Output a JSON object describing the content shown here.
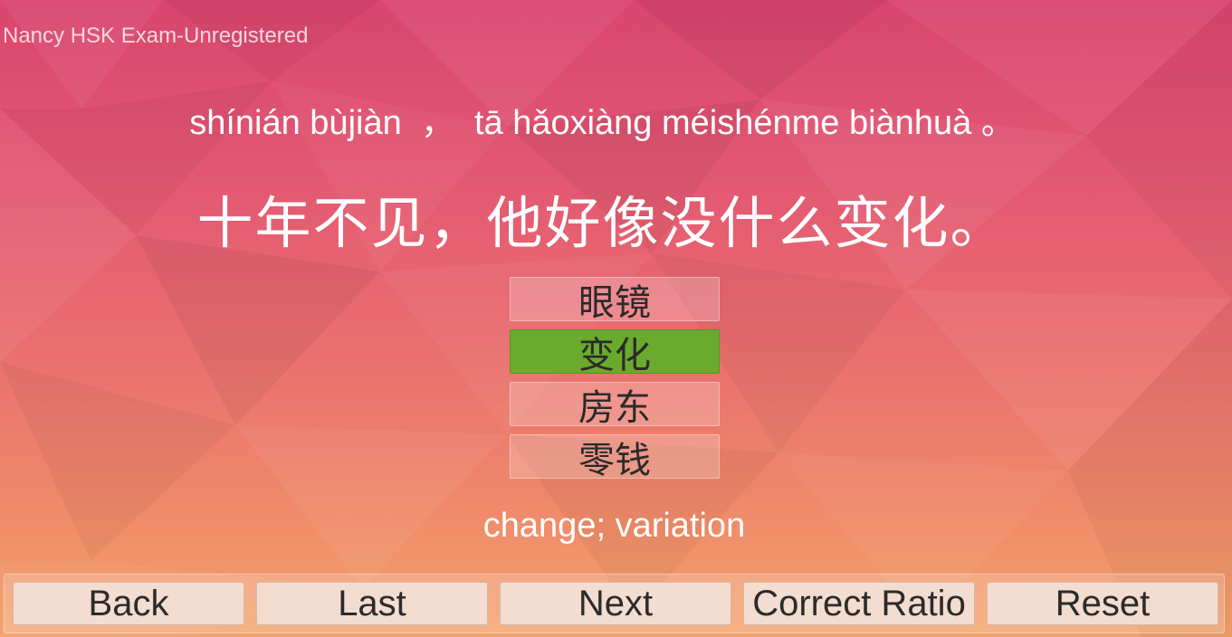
{
  "app": {
    "title": "Nancy HSK Exam-Unregistered"
  },
  "question": {
    "pinyin": "shínián bùjiàn  ，  tā hǎoxiàng méishénme biànhuà 。",
    "hanzi": "十年不见，他好像没什么变化。"
  },
  "choices": [
    {
      "label": "眼镜",
      "selected": false
    },
    {
      "label": "变化",
      "selected": true
    },
    {
      "label": "房东",
      "selected": false
    },
    {
      "label": "零钱",
      "selected": false
    }
  ],
  "meaning": "change; variation",
  "toolbar": {
    "back_label": "Back",
    "last_label": "Last",
    "next_label": "Next",
    "ratio_label": "Correct Ratio",
    "reset_label": "Reset"
  },
  "colors": {
    "selected_choice": "#6aaa2c",
    "background_top": "#d9456f",
    "background_bottom": "#f3a26a"
  }
}
